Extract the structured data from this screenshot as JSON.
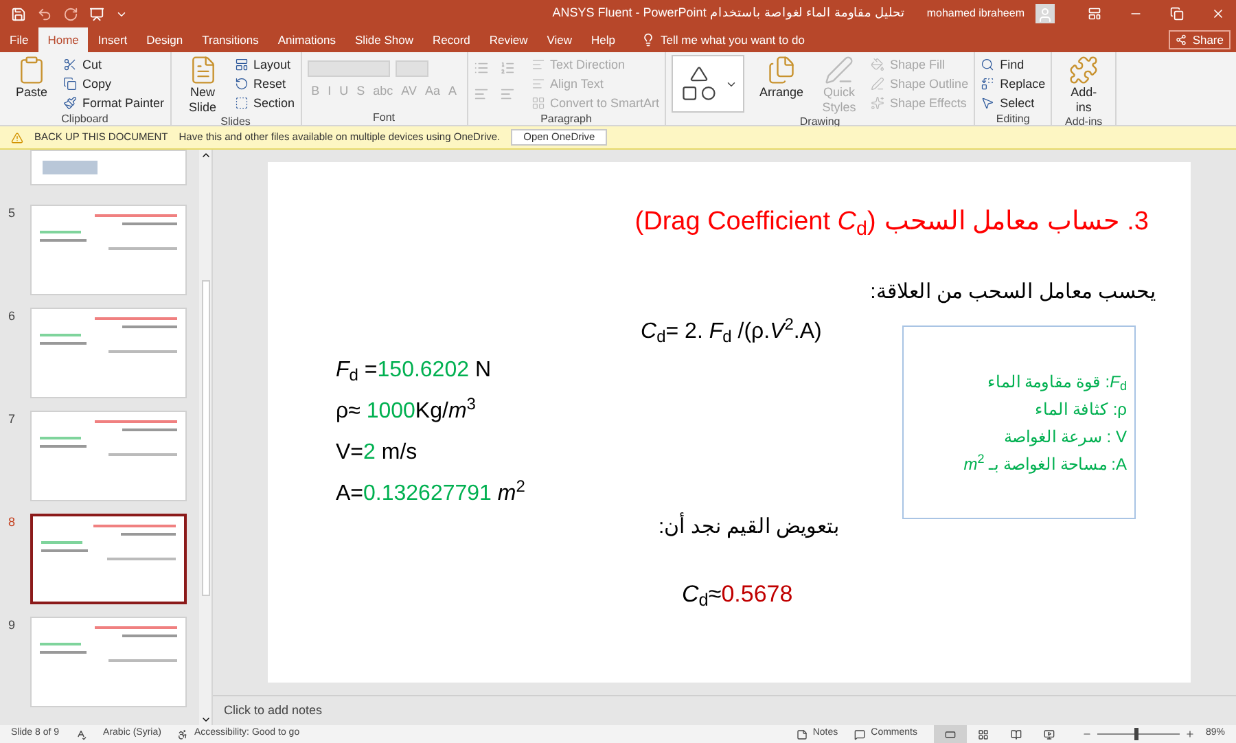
{
  "title_bar": {
    "title": "تحليل مقاومة الماء لغواصة باستخدام ANSYS Fluent  -  PowerPoint",
    "user": "mohamed ibraheem"
  },
  "tabs": [
    {
      "label": "File",
      "selected": false
    },
    {
      "label": "Home",
      "selected": true
    },
    {
      "label": "Insert",
      "selected": false
    },
    {
      "label": "Design",
      "selected": false
    },
    {
      "label": "Transitions",
      "selected": false
    },
    {
      "label": "Animations",
      "selected": false
    },
    {
      "label": "Slide Show",
      "selected": false
    },
    {
      "label": "Record",
      "selected": false
    },
    {
      "label": "Review",
      "selected": false
    },
    {
      "label": "View",
      "selected": false
    },
    {
      "label": "Help",
      "selected": false
    }
  ],
  "tell_me": {
    "placeholder": "Tell me what you want to do"
  },
  "share": "Share",
  "ribbon": [
    {
      "label": "Clipboard",
      "kind": "standard",
      "items": [
        {
          "label": "Paste",
          "kind": "large",
          "disabled": false
        },
        {
          "label": "Cut",
          "kind": "small",
          "disabled": false
        },
        {
          "label": "Copy",
          "kind": "small",
          "disabled": false
        },
        {
          "label": "Format Painter",
          "kind": "small",
          "disabled": false
        }
      ]
    },
    {
      "label": "Slides",
      "kind": "standard",
      "items": [
        {
          "label": "New Slide",
          "kind": "large",
          "disabled": false
        },
        {
          "label": "Layout",
          "kind": "small",
          "disabled": false
        },
        {
          "label": "Reset",
          "kind": "small",
          "disabled": false
        },
        {
          "label": "Section",
          "kind": "small",
          "disabled": false
        }
      ]
    },
    {
      "label": "Font",
      "kind": "font",
      "items": [
        {
          "label": "B",
          "kind": "glyph",
          "disabled": true
        },
        {
          "label": "I",
          "kind": "glyph",
          "disabled": true
        },
        {
          "label": "U",
          "kind": "glyph",
          "disabled": true
        },
        {
          "label": "S",
          "kind": "glyph",
          "disabled": true
        },
        {
          "label": "abc",
          "kind": "glyph",
          "disabled": true
        },
        {
          "label": "AV",
          "kind": "glyph",
          "disabled": true
        },
        {
          "label": "Aa",
          "kind": "glyph",
          "disabled": true
        },
        {
          "label": "A",
          "kind": "glyph",
          "disabled": true
        }
      ]
    },
    {
      "label": "Paragraph",
      "kind": "paragraph",
      "items": [
        {
          "label": "Text Direction",
          "kind": "small",
          "disabled": true
        },
        {
          "label": "Align Text",
          "kind": "small",
          "disabled": true
        },
        {
          "label": "Convert to SmartArt",
          "kind": "small",
          "disabled": true
        }
      ]
    },
    {
      "label": "Drawing",
      "kind": "drawing",
      "items": [
        {
          "label": "Arrange",
          "kind": "large",
          "disabled": false
        },
        {
          "label": "Quick Styles",
          "kind": "large",
          "disabled": true
        },
        {
          "label": "Shape Fill",
          "kind": "small",
          "disabled": true
        },
        {
          "label": "Shape Outline",
          "kind": "small",
          "disabled": true
        },
        {
          "label": "Shape Effects",
          "kind": "small",
          "disabled": true
        }
      ]
    },
    {
      "label": "Editing",
      "kind": "standard",
      "items": [
        {
          "label": "Find",
          "kind": "small",
          "disabled": false
        },
        {
          "label": "Replace",
          "kind": "small",
          "disabled": false
        },
        {
          "label": "Select",
          "kind": "small",
          "disabled": false
        }
      ]
    },
    {
      "label": "Add-ins",
      "kind": "standard",
      "items": [
        {
          "label": "Add-ins",
          "kind": "large",
          "disabled": false
        }
      ]
    }
  ],
  "notification": {
    "title": "BACK UP THIS DOCUMENT",
    "message": "Have this and other files available on multiple devices using OneDrive.",
    "button": "Open OneDrive"
  },
  "thumbnails": [
    {
      "number": "5",
      "selected": false
    },
    {
      "number": "6",
      "selected": false
    },
    {
      "number": "7",
      "selected": false
    },
    {
      "number": "8",
      "selected": true
    },
    {
      "number": "9",
      "selected": false
    }
  ],
  "slide": {
    "title": "3. حساب معامل السحب",
    "title_en": "(Drag Coefficient *C*$_{d}$)",
    "intro": "يحسب معامل السحب من العلاقة:",
    "formula": "*C*$_{d}$= 2. *F*$_{d}$ /(ρ.*V*$^{2}$.A)",
    "variables": [
      [
        {
          "text": "*F*$_{d}$ =",
          "kind": "plain"
        },
        {
          "text": "150.6202",
          "kind": "value"
        },
        {
          "text": " N",
          "kind": "plain"
        }
      ],
      [
        {
          "text": "ρ≈ ",
          "kind": "plain"
        },
        {
          "text": "1000",
          "kind": "value"
        },
        {
          "text": "Kg/*m*$^{3}$",
          "kind": "plain"
        }
      ],
      [
        {
          "text": "V=",
          "kind": "plain"
        },
        {
          "text": "2",
          "kind": "value"
        },
        {
          "text": " m/s",
          "kind": "plain"
        }
      ],
      [
        {
          "text": "A=",
          "kind": "plain"
        },
        {
          "text": "0.132627791",
          "kind": "value"
        },
        {
          "text": " *m*$^{2}$",
          "kind": "plain"
        }
      ]
    ],
    "legend": [
      "*F*$_{d}$: قوة مقاومة الماء",
      "ρ: كثافة الماء",
      "V : سرعة الغواصة",
      "A: مساحة الغواصة بـ *m*$^{2}$"
    ],
    "substitution": "بتعويض القيم نجد أن:",
    "result": [
      {
        "text": "*C*$_{d}$≈",
        "kind": "plain"
      },
      {
        "text": "0.5678",
        "kind": "result"
      }
    ]
  },
  "notes": {
    "placeholder": "Click to add notes"
  },
  "status_bar": {
    "slide": "Slide 8 of 9",
    "language": "Arabic (Syria)",
    "accessibility": "Accessibility: Good to go",
    "notes": "Notes",
    "comments": "Comments",
    "views": [
      {
        "kind": "normal",
        "selected": true
      },
      {
        "kind": "sorter",
        "selected": false
      },
      {
        "kind": "reading",
        "selected": false
      },
      {
        "kind": "slideshow",
        "selected": false
      }
    ],
    "zoom": {
      "level": 0.45,
      "reading": "89%"
    }
  }
}
